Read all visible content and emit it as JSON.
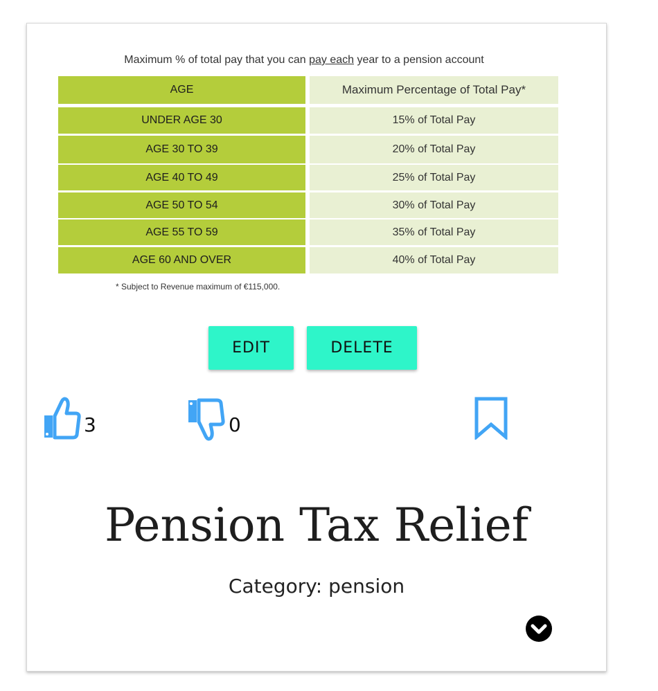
{
  "caption": {
    "before": "Maximum % of total pay that you can",
    "underlined": "pay each",
    "after": "year to a pension account"
  },
  "table": {
    "headers": [
      "AGE",
      "Maximum Percentage of Total Pay*"
    ],
    "rows": [
      [
        "UNDER AGE 30",
        "15% of Total Pay"
      ],
      [
        "AGE 30 TO 39",
        "20% of Total Pay"
      ],
      [
        "AGE 40 TO 49",
        "25% of Total Pay"
      ],
      [
        "AGE 50 TO 54",
        "30% of Total Pay"
      ],
      [
        "AGE 55 TO 59",
        "35% of Total Pay"
      ],
      [
        "AGE 60 AND OVER",
        "40% of Total Pay"
      ]
    ],
    "footnote": "* Subject to Revenue maximum of €115,000."
  },
  "actions": {
    "edit_label": "EDIT",
    "delete_label": "DELETE"
  },
  "reactions": {
    "likes": "3",
    "dislikes": "0"
  },
  "post": {
    "title": "Pension Tax Relief",
    "category": "Category: pension"
  },
  "colors": {
    "accent_button": "#2ef5c9",
    "icon_blue": "#42a5f5",
    "table_green": "#b4cd3b",
    "table_light": "#e9f0d3"
  },
  "icons": [
    "thumbs-up-icon",
    "thumbs-down-icon",
    "bookmark-icon",
    "chevron-down-circle-icon"
  ]
}
